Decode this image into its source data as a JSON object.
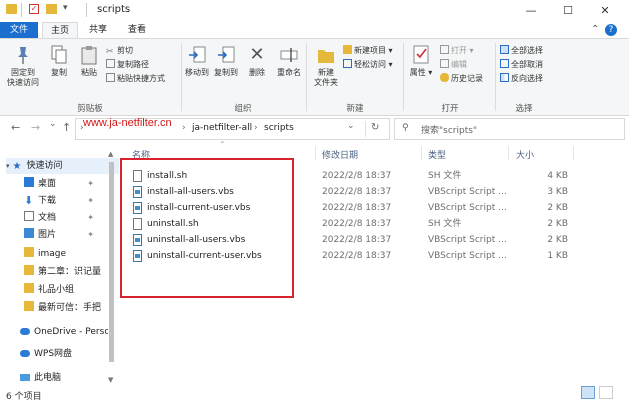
{
  "window": {
    "title": "scripts",
    "minimize": "—",
    "maximize": "☐",
    "close": "✕",
    "quick_access_toolbar": [
      "save-icon",
      "checkmark-icon",
      "folder-icon",
      "dropdown-icon"
    ]
  },
  "tabs": {
    "file": "文件",
    "home": "主页",
    "share": "共享",
    "view": "查看",
    "expand": "⌃",
    "help": "?"
  },
  "ribbon": {
    "clipboard": {
      "pin": "固定到\n快速访问",
      "copy": "复制",
      "paste": "粘贴",
      "cut": "剪切",
      "copy_path": "复制路径",
      "paste_shortcut": "粘贴快捷方式",
      "label": "剪贴板"
    },
    "organize": {
      "move_to": "移动到",
      "copy_to": "复制到",
      "delete": "删除",
      "rename": "重命名",
      "label": "组织"
    },
    "new": {
      "new_folder": "新建\n文件夹",
      "new_item": "新建项目",
      "easy_access": "轻松访问",
      "label": "新建"
    },
    "open": {
      "properties": "属性",
      "open": "打开",
      "edit": "编辑",
      "history": "历史记录",
      "label": "打开"
    },
    "select": {
      "select_all": "全部选择",
      "select_none": "全部取消",
      "invert": "反向选择",
      "label": "选择"
    }
  },
  "address": {
    "back": "←",
    "forward": "→",
    "recent": "⌄",
    "up": "↑",
    "crumbs": [
      "›",
      "›",
      "ja-netfilter-all",
      "›",
      "scripts"
    ],
    "dropdown": "⌄",
    "refresh": "↻",
    "search_placeholder": "搜索\"scripts\"",
    "watermark": "www.ja-netfilter.cn"
  },
  "sidebar": {
    "items": [
      {
        "label": "快速访问",
        "icon": "star-icon",
        "pinned": false
      },
      {
        "label": "桌面",
        "icon": "desktop-icon",
        "pinned": true
      },
      {
        "label": "下载",
        "icon": "download-icon",
        "pinned": true
      },
      {
        "label": "文档",
        "icon": "document-icon",
        "pinned": true
      },
      {
        "label": "图片",
        "icon": "picture-icon",
        "pinned": true
      },
      {
        "label": "image",
        "icon": "folder-icon",
        "pinned": false
      },
      {
        "label": "第二章：识记量",
        "icon": "folder-icon",
        "pinned": false
      },
      {
        "label": "礼品小组",
        "icon": "folder-icon",
        "pinned": false
      },
      {
        "label": "最新可信：手把",
        "icon": "folder-icon",
        "pinned": false
      },
      {
        "label": "OneDrive - Perso",
        "icon": "cloud-icon",
        "pinned": false
      },
      {
        "label": "WPS网盘",
        "icon": "cloud-icon",
        "pinned": false
      },
      {
        "label": "此电脑",
        "icon": "computer-icon",
        "pinned": false
      }
    ],
    "pin_glyph": "📌"
  },
  "columns": {
    "name": "名称",
    "date": "修改日期",
    "type": "类型",
    "size": "大小"
  },
  "files": [
    {
      "name": "install.sh",
      "date": "2022/2/8 18:37",
      "type": "SH 文件",
      "size": "4 KB",
      "icon": "sh-file-icon"
    },
    {
      "name": "install-all-users.vbs",
      "date": "2022/2/8 18:37",
      "type": "VBScript Script ...",
      "size": "3 KB",
      "icon": "vbs-file-icon"
    },
    {
      "name": "install-current-user.vbs",
      "date": "2022/2/8 18:37",
      "type": "VBScript Script ...",
      "size": "2 KB",
      "icon": "vbs-file-icon"
    },
    {
      "name": "uninstall.sh",
      "date": "2022/2/8 18:37",
      "type": "SH 文件",
      "size": "2 KB",
      "icon": "sh-file-icon"
    },
    {
      "name": "uninstall-all-users.vbs",
      "date": "2022/2/8 18:37",
      "type": "VBScript Script ...",
      "size": "2 KB",
      "icon": "vbs-file-icon"
    },
    {
      "name": "uninstall-current-user.vbs",
      "date": "2022/2/8 18:37",
      "type": "VBScript Script ...",
      "size": "1 KB",
      "icon": "vbs-file-icon"
    }
  ],
  "status": {
    "count": "6 个项目"
  },
  "colors": {
    "accent": "#1a6fcf",
    "highlight_box": "#d9232e",
    "watermark": "#d01717"
  }
}
